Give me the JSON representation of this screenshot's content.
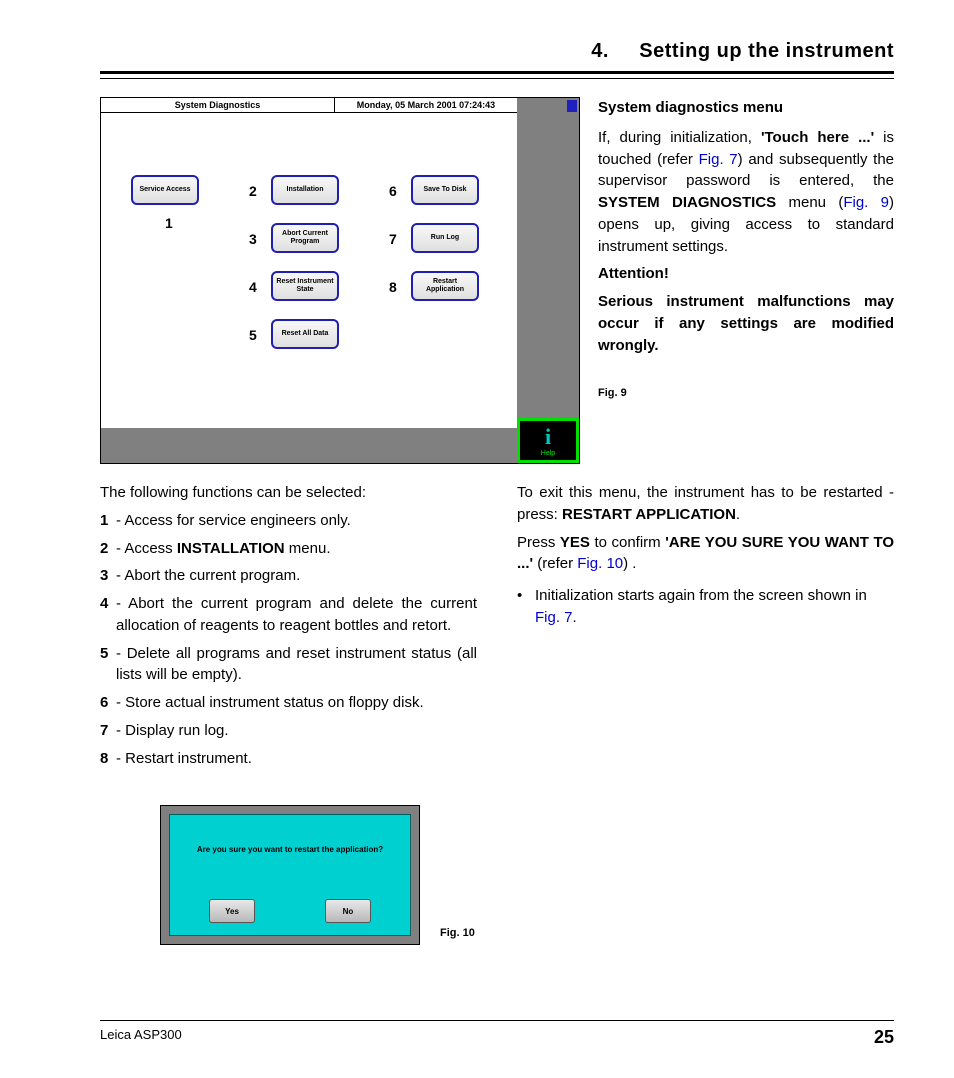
{
  "header": {
    "section_number": "4.",
    "section_title": "Setting up the instrument"
  },
  "screenshot9": {
    "title_left": "System Diagnostics",
    "title_right": "Monday, 05 March 2001 07:24:43",
    "buttons": {
      "b1": "Service Access",
      "b2": "Installation",
      "b3": "Abort Current Program",
      "b4": "Reset Instrument State",
      "b5": "Reset All Data",
      "b6": "Save To Disk",
      "b7": "Run Log",
      "b8": "Restart Application"
    },
    "labels": {
      "n1": "1",
      "n2": "2",
      "n3": "3",
      "n4": "4",
      "n5": "5",
      "n6": "6",
      "n7": "7",
      "n8": "8"
    },
    "help_label": "Help"
  },
  "side": {
    "heading": "System diagnostics menu",
    "p1a": "If, during initialization, ",
    "p1b": "'Touch here ...'",
    "p1c": " is touched (refer ",
    "p1d": "Fig. 7",
    "p1e": ") and subsequently the supervisor password is entered, the ",
    "p1f": "SYSTEM DIAGNOSTICS",
    "p1g": " menu (",
    "p1h": "Fig. 9",
    "p1i": ") opens up, giving access to standard instrument settings.",
    "attention": "Attention!",
    "warn": "Serious instrument malfunctions may occur if any settings are modified wrongly.",
    "fig9": "Fig. 9"
  },
  "lower_left": {
    "intro": "The following functions can be selected:",
    "items": [
      {
        "n": "1",
        "pre": " - Access for service engineers only."
      },
      {
        "n": "2",
        "pre": " - Access ",
        "bold": "INSTALLATION",
        "post": " menu."
      },
      {
        "n": "3",
        "pre": " - Abort the current program."
      },
      {
        "n": "4",
        "pre": " - Abort the current program and delete the current allocation of reagents to reagent bottles and retort."
      },
      {
        "n": "5",
        "pre": " - Delete all programs and reset instrument status (all lists will be empty)."
      },
      {
        "n": "6",
        "pre": " - Store actual instrument status on floppy disk."
      },
      {
        "n": "7",
        "pre": " - Display run log."
      },
      {
        "n": "8",
        "pre": " - Restart instrument."
      }
    ]
  },
  "lower_right": {
    "p1a": "To exit this menu, the instrument has to be restarted - press: ",
    "p1b": "RESTART APPLICATION",
    "p1c": ".",
    "p2a": "Press ",
    "p2b": "YES",
    "p2c": " to confirm ",
    "p2d": "'ARE YOU SURE YOU WANT TO ...'",
    "p2e": " (refer ",
    "p2f": "Fig. 10",
    "p2g": ") .",
    "bullet_a": "Initialization starts again from the screen shown in ",
    "bullet_b": "Fig. 7",
    "bullet_c": "."
  },
  "dialog": {
    "msg": "Are you sure you want to restart the application?",
    "yes": "Yes",
    "no": "No",
    "fig10": "Fig. 10"
  },
  "footer": {
    "product": "Leica  ASP300",
    "page": "25"
  }
}
